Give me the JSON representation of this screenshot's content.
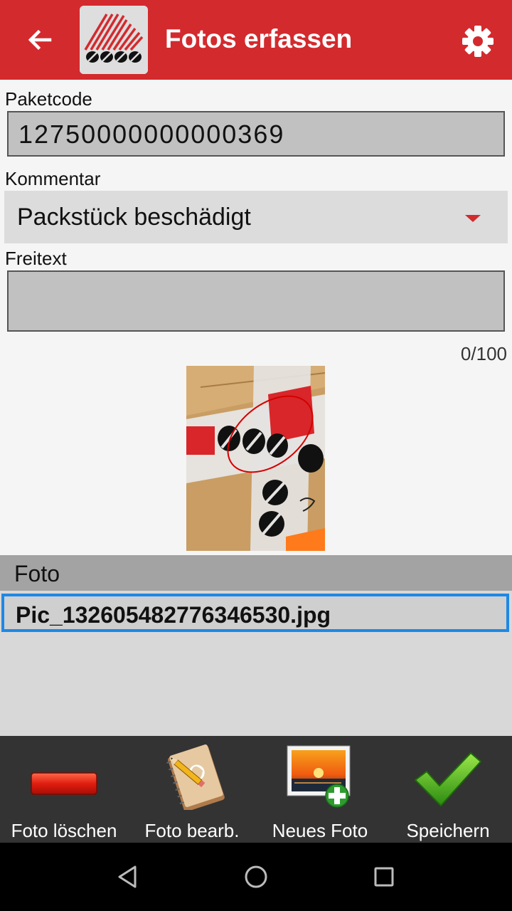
{
  "appbar": {
    "title": "Fotos erfassen",
    "color": "#d32a2e",
    "back_icon": "arrow-left-icon",
    "settings_icon": "gear-icon"
  },
  "form": {
    "paketcode_label": "Paketcode",
    "paketcode_value": "12750000000000369",
    "kommentar_label": "Kommentar",
    "kommentar_value": "Packstück beschädigt",
    "freitext_label": "Freitext",
    "freitext_value": "",
    "counter": "0/100"
  },
  "photo_list": {
    "header": "Foto",
    "items": [
      {
        "filename": "Pic_132605482776346530.jpg",
        "selected": true
      }
    ]
  },
  "toolbar": {
    "items": [
      {
        "label": "Foto löschen",
        "icon": "minus-icon"
      },
      {
        "label": "Foto bearb.",
        "icon": "notebook-pencil-icon"
      },
      {
        "label": "Neues Foto",
        "icon": "add-photo-icon"
      },
      {
        "label": "Speichern",
        "icon": "checkmark-icon"
      }
    ]
  },
  "navbar": {
    "back_icon": "nav-back-icon",
    "home_icon": "nav-home-icon",
    "recents_icon": "nav-recents-icon"
  },
  "accent_colors": {
    "selection": "#1e88e5",
    "toolbar_bg": "#333333"
  }
}
